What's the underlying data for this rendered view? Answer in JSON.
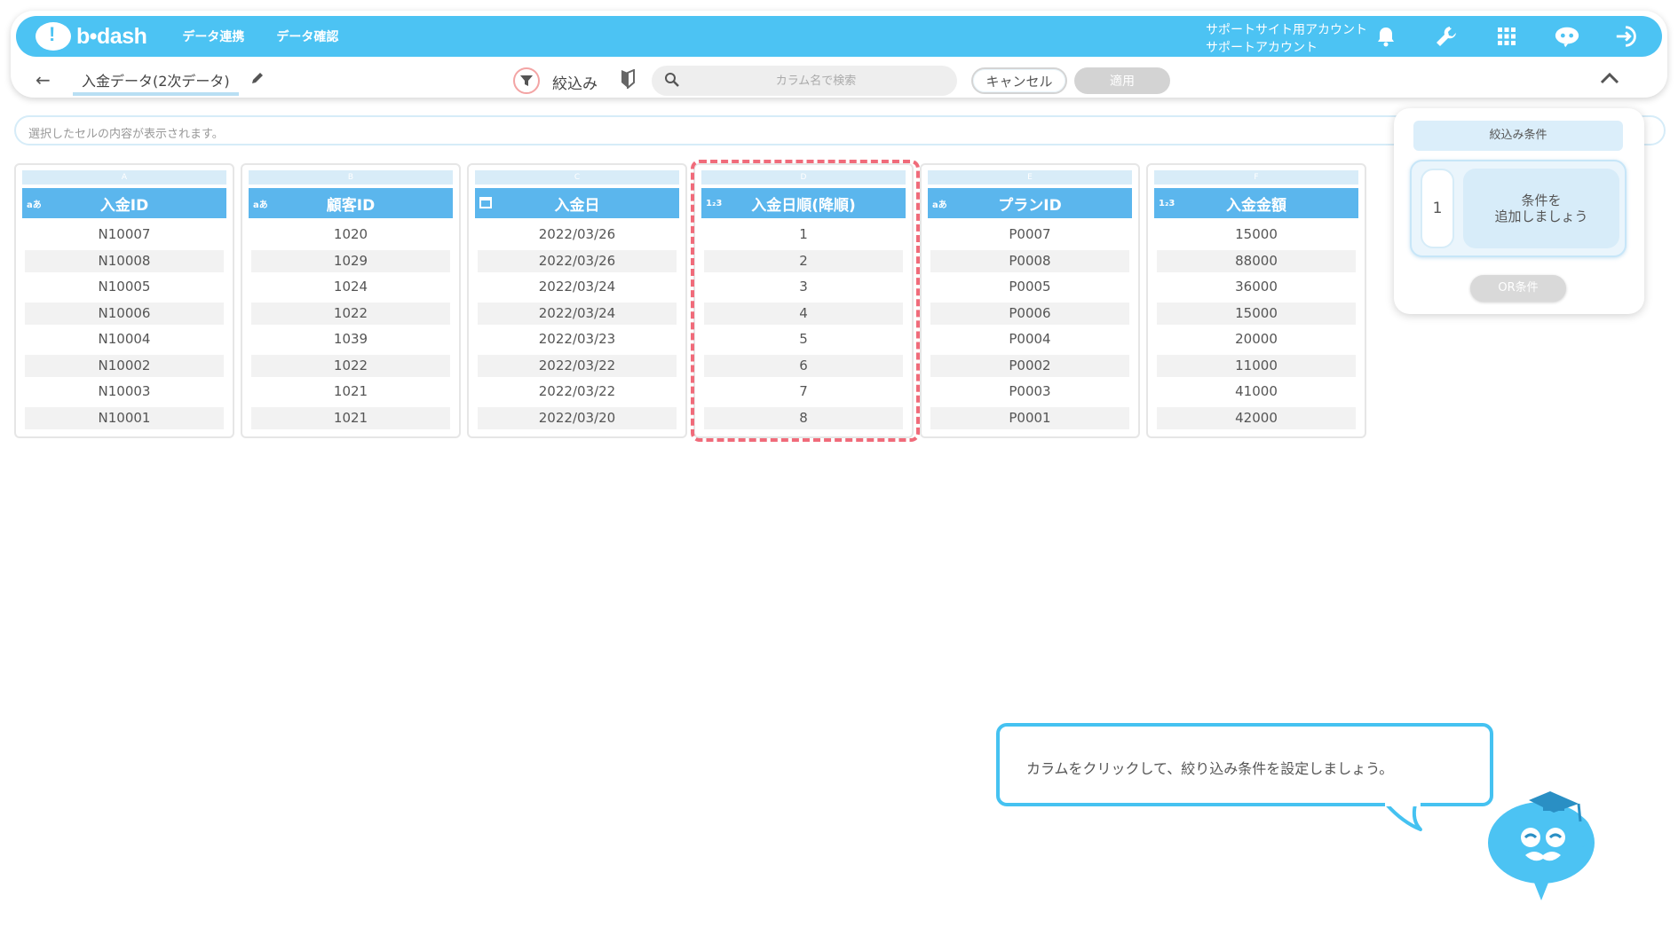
{
  "nav": {
    "logo_text": "b•dash",
    "items": [
      "データ連携",
      "データ確認"
    ],
    "account_line1": "サポートサイト用アカウント",
    "account_line2": "サポートアカウント",
    "icons": [
      "bell-icon",
      "wrench-icon",
      "grid-icon",
      "chat-robot-icon",
      "logout-icon"
    ]
  },
  "toolbar": {
    "back_icon": "back-arrow-icon",
    "title": "入金データ(2次データ)",
    "filter_label": "絞込み",
    "search_placeholder": "カラム名で検索",
    "cancel_label": "キャンセル",
    "apply_label": "適用"
  },
  "cellbar": {
    "placeholder": "選択したセルの内容が表示されます。"
  },
  "table": {
    "columns": [
      {
        "letter": "A",
        "type": "aあ",
        "name": "入金ID",
        "values": [
          "N10007",
          "N10008",
          "N10005",
          "N10006",
          "N10004",
          "N10002",
          "N10003",
          "N10001"
        ]
      },
      {
        "letter": "B",
        "type": "aあ",
        "name": "顧客ID",
        "values": [
          "1020",
          "1029",
          "1024",
          "1022",
          "1039",
          "1022",
          "1021",
          "1021"
        ]
      },
      {
        "letter": "C",
        "type": "calendar",
        "name": "入金日",
        "values": [
          "2022/03/26",
          "2022/03/26",
          "2022/03/24",
          "2022/03/24",
          "2022/03/23",
          "2022/03/22",
          "2022/03/22",
          "2022/03/20"
        ]
      },
      {
        "letter": "D",
        "type": "1₂3",
        "name": "入金日順(降順)",
        "values": [
          "1",
          "2",
          "3",
          "4",
          "5",
          "6",
          "7",
          "8"
        ]
      },
      {
        "letter": "E",
        "type": "aあ",
        "name": "プランID",
        "values": [
          "P0007",
          "P0008",
          "P0005",
          "P0006",
          "P0004",
          "P0002",
          "P0003",
          "P0001"
        ]
      },
      {
        "letter": "F",
        "type": "1₂3",
        "name": "入金金額",
        "values": [
          "15000",
          "88000",
          "36000",
          "15000",
          "20000",
          "11000",
          "41000",
          "42000"
        ]
      }
    ]
  },
  "panel": {
    "title": "絞込み条件",
    "condition_number": "1",
    "condition_text": "条件を\n追加しましょう",
    "or_label": "OR条件"
  },
  "bubble": {
    "text": "カラムをクリックして、絞り込み条件を設定しましょう。"
  },
  "colors": {
    "accent": "#4cc3f3",
    "header": "#5bb6ed",
    "highlight": "#f06b7a"
  }
}
